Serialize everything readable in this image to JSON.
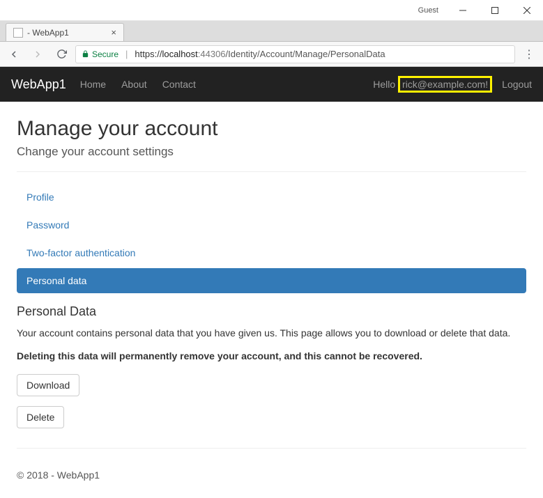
{
  "window": {
    "guest_label": "Guest",
    "tab_title": " - WebApp1"
  },
  "addressbar": {
    "secure_label": "Secure",
    "scheme": "https",
    "host": "localhost",
    "port": ":44306",
    "path": "/Identity/Account/Manage/PersonalData",
    "full_url": "https://localhost:44306/Identity/Account/Manage/PersonalData"
  },
  "navbar": {
    "brand": "WebApp1",
    "links": [
      "Home",
      "About",
      "Contact"
    ],
    "hello_prefix": "Hello ",
    "user_email": "rick@example.com!",
    "logout": "Logout"
  },
  "page": {
    "title": "Manage your account",
    "subtitle": "Change your account settings",
    "pills": [
      {
        "label": "Profile",
        "active": false
      },
      {
        "label": "Password",
        "active": false
      },
      {
        "label": "Two-factor authentication",
        "active": false
      },
      {
        "label": "Personal data",
        "active": true
      }
    ],
    "section_title": "Personal Data",
    "body_text": "Your account contains personal data that you have given us. This page allows you to download or delete that data.",
    "warning_text": "Deleting this data will permanently remove your account, and this cannot be recovered.",
    "download_label": "Download",
    "delete_label": "Delete"
  },
  "footer": {
    "text": "© 2018 - WebApp1"
  }
}
